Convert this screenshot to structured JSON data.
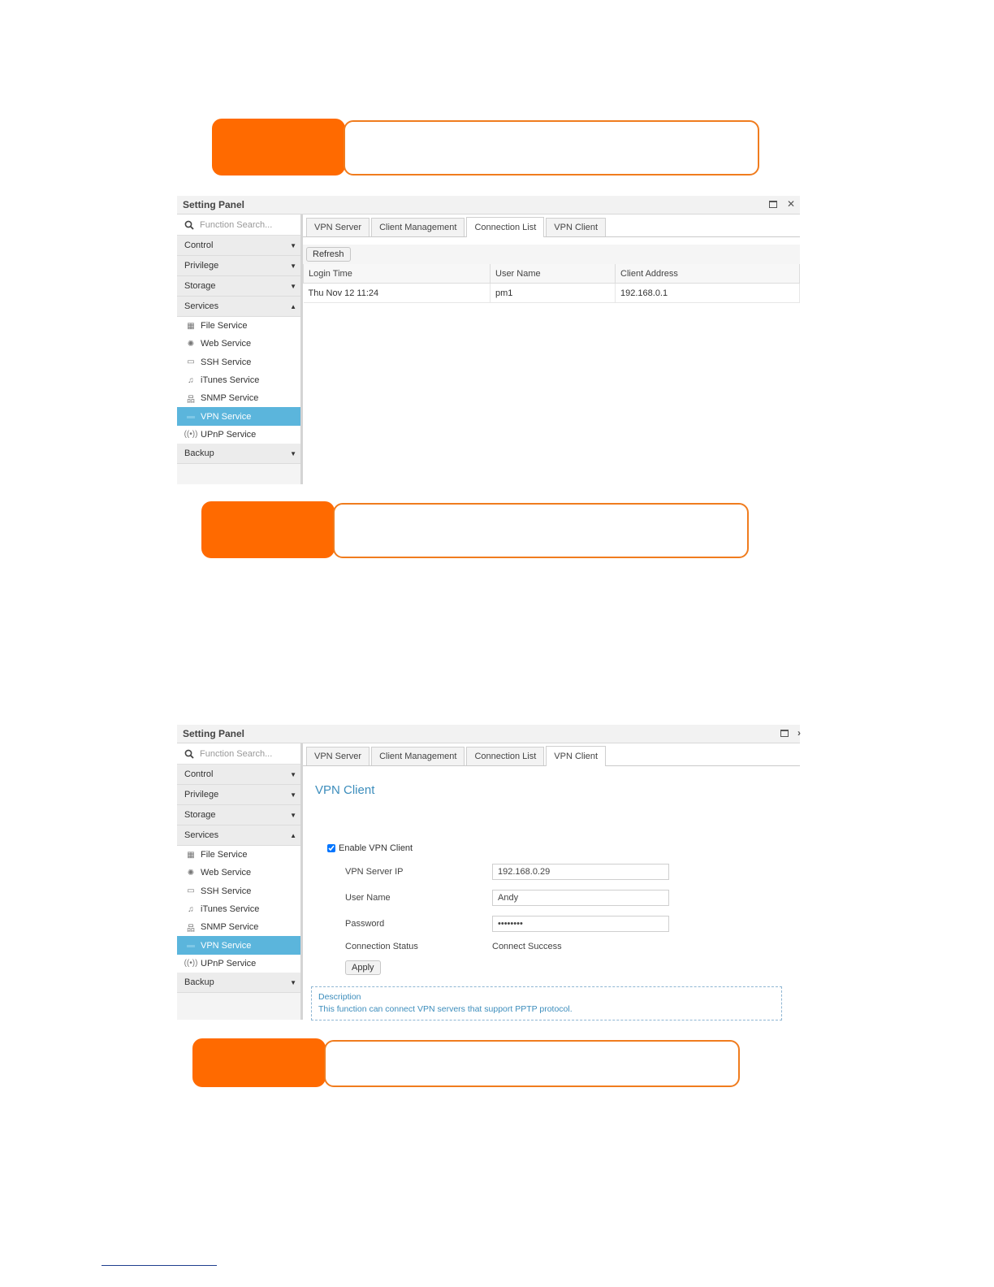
{
  "panel1": {
    "title": "Setting Panel",
    "search_placeholder": "Function Search...",
    "nav": {
      "control": "Control",
      "privilege": "Privilege",
      "storage": "Storage",
      "services": "Services",
      "backup": "Backup",
      "items": [
        "File Service",
        "Web Service",
        "SSH Service",
        "iTunes Service",
        "SNMP Service",
        "VPN Service",
        "UPnP Service"
      ]
    },
    "tabs": [
      "VPN Server",
      "Client Management",
      "Connection List",
      "VPN Client"
    ],
    "active_tab": "Connection List",
    "refresh_label": "Refresh",
    "columns": [
      "Login Time",
      "User Name",
      "Client Address"
    ],
    "rows": [
      [
        "Thu Nov 12 11:24",
        "pm1",
        "192.168.0.1"
      ]
    ]
  },
  "panel2": {
    "title": "Setting Panel",
    "search_placeholder": "Function Search...",
    "nav": {
      "control": "Control",
      "privilege": "Privilege",
      "storage": "Storage",
      "services": "Services",
      "backup": "Backup",
      "items": [
        "File Service",
        "Web Service",
        "SSH Service",
        "iTunes Service",
        "SNMP Service",
        "VPN Service",
        "UPnP Service"
      ]
    },
    "tabs": [
      "VPN Server",
      "Client Management",
      "Connection List",
      "VPN Client"
    ],
    "active_tab": "VPN Client",
    "form": {
      "heading": "VPN Client",
      "enable_label": "Enable VPN Client",
      "enable_checked": true,
      "server_ip_label": "VPN Server IP",
      "server_ip_value": "192.168.0.29",
      "user_name_label": "User Name",
      "user_name_value": "Andy",
      "password_label": "Password",
      "password_value": "••••••••",
      "status_label": "Connection Status",
      "status_value": "Connect Success",
      "apply_label": "Apply"
    },
    "description": {
      "title": "Description",
      "text": "This function can connect VPN servers that support PPTP protocol."
    }
  },
  "colors": {
    "accent_orange": "#ff6a00",
    "active_nav": "#5bb5dc",
    "link_blue": "#3c8dbc"
  }
}
